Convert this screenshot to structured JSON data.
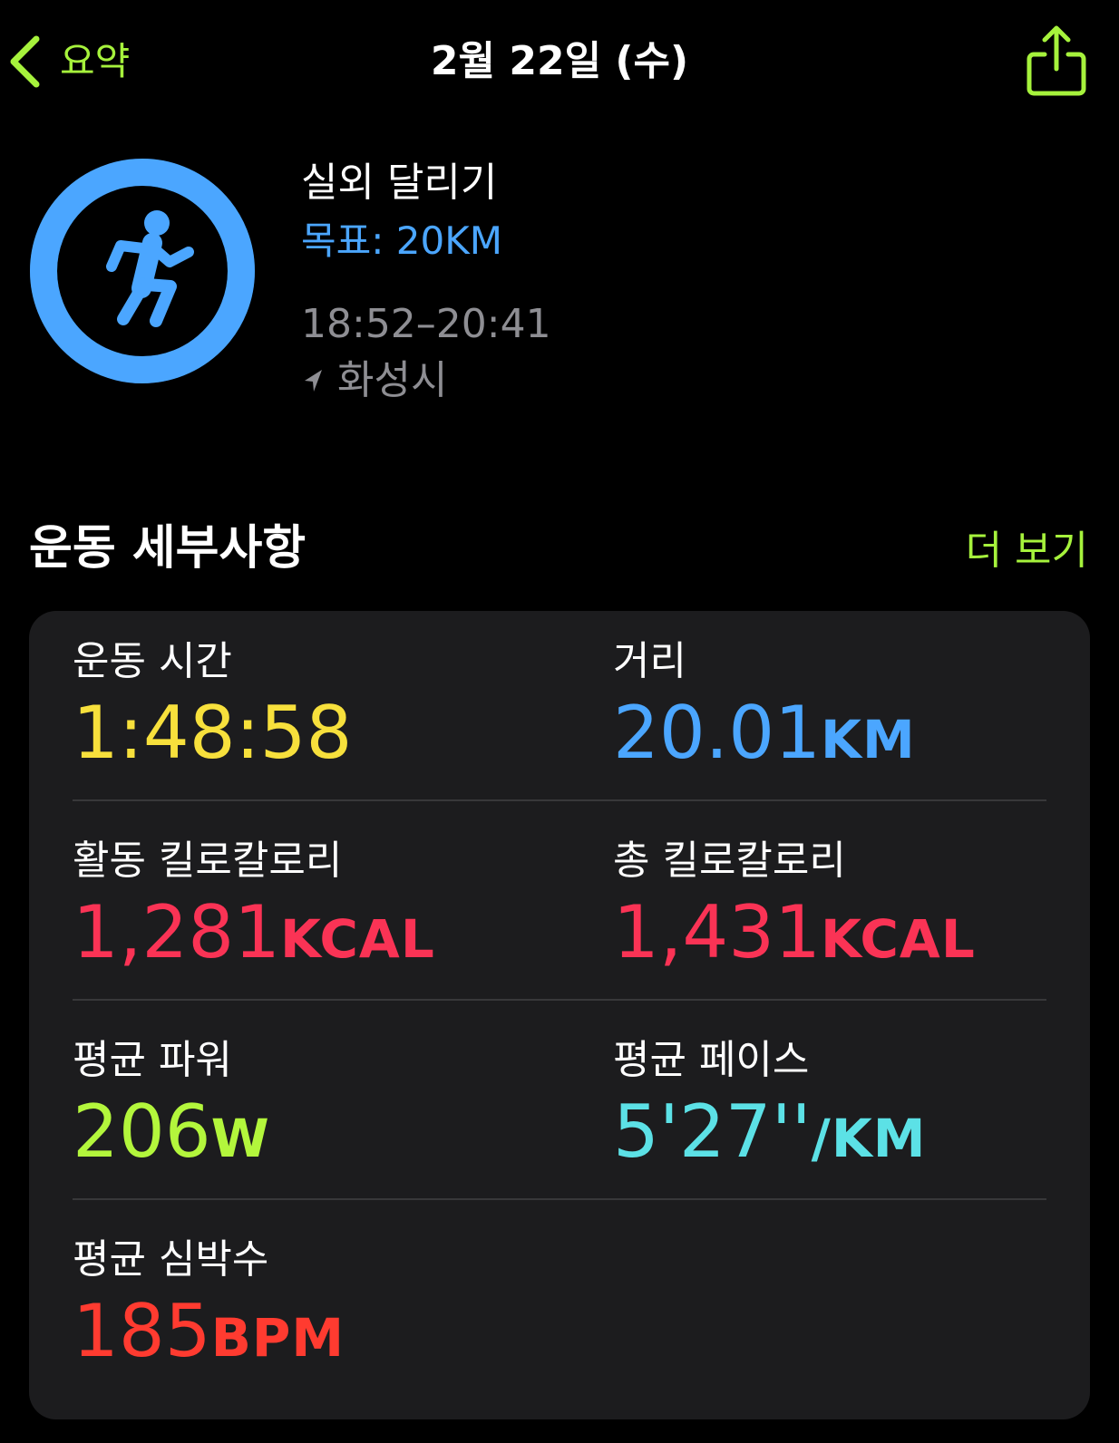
{
  "nav": {
    "back_label": "요약",
    "title": "2월 22일 (수)",
    "back_icon": "chevron-left-icon",
    "share_icon": "share-icon",
    "accent_color": "#a6f23c"
  },
  "workout": {
    "name": "실외 달리기",
    "goal": "목표: 20KM",
    "time_range": "18:52–20:41",
    "location": "화성시",
    "ring_color": "#4ba6ff",
    "goal_progress": 1.0,
    "icon": "running-figure-icon",
    "location_icon": "location-arrow-icon"
  },
  "details": {
    "title": "운동 세부사항",
    "show_more_label": "더 보기",
    "metrics": [
      {
        "label": "운동 시간",
        "value": "1:48:58",
        "unit": "",
        "color": "#f7e03c"
      },
      {
        "label": "거리",
        "value": "20.01",
        "unit": "KM",
        "color": "#4ba6ff"
      },
      {
        "label": "활동 킬로칼로리",
        "value": "1,281",
        "unit": "KCAL",
        "color": "#fa3355"
      },
      {
        "label": "총 킬로칼로리",
        "value": "1,431",
        "unit": "KCAL",
        "color": "#fa3355"
      },
      {
        "label": "평균 파워",
        "value": "206",
        "unit": "W",
        "color": "#b3f63c"
      },
      {
        "label": "평균 페이스",
        "value": "5'27''",
        "unit": "/KM",
        "color": "#5ce1e6"
      },
      {
        "label": "평균 심박수",
        "value": "185",
        "unit": "BPM",
        "color": "#ff3b30"
      }
    ]
  }
}
